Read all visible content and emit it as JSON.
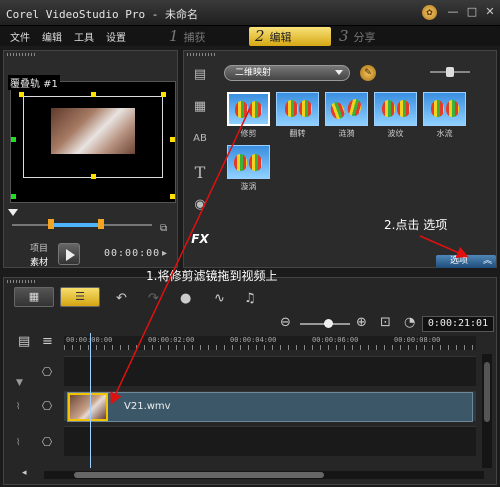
{
  "window": {
    "title": "Corel VideoStudio Pro - 未命名",
    "minimize": "—",
    "maximize": "□",
    "close": "✕"
  },
  "menu": {
    "items": [
      "文件",
      "编辑",
      "工具",
      "设置"
    ]
  },
  "steps": [
    {
      "num": "1",
      "label": "捕获"
    },
    {
      "num": "2",
      "label": "编辑"
    },
    {
      "num": "3",
      "label": "分享"
    }
  ],
  "preview": {
    "track_label": "覆叠轨 #1",
    "mode_project": "项目",
    "mode_clip": "素材",
    "timecode": "00:00:00"
  },
  "library": {
    "category": "二维映射",
    "sidebar": [
      {
        "icon": "media-icon",
        "glyph": "▤"
      },
      {
        "icon": "instant-project-icon",
        "glyph": "▦"
      },
      {
        "icon": "transition-icon",
        "glyph": "AB"
      },
      {
        "icon": "title-icon",
        "glyph": "T"
      },
      {
        "icon": "graphic-icon",
        "glyph": "◉"
      },
      {
        "icon": "filter-icon",
        "glyph": "FX"
      }
    ],
    "thumbnails": [
      "修剪",
      "翻转",
      "涟漪",
      "波纹",
      "水流",
      "漩涡"
    ],
    "options_label": "选项",
    "options_chevron": "︽"
  },
  "annotations": {
    "step1": "1.将修剪滤镜拖到视频上",
    "step2": "2.点击 选项"
  },
  "timeline": {
    "project_time": "0:00:21:01",
    "ruler_ticks": [
      "00:00:00:00",
      "00:00:02:00",
      "00:00:04:00",
      "00:00:06:00",
      "00:00:08:00"
    ],
    "clip_name": "V21.wmv"
  },
  "colors": {
    "accent_yellow": "#f3c300",
    "accent_blue": "#4fb4ff",
    "annotation_red": "#e01010"
  }
}
